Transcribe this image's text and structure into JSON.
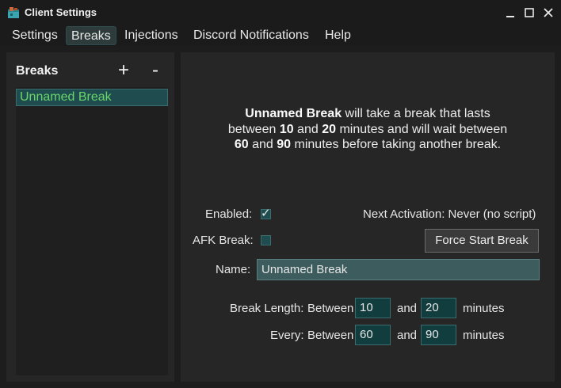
{
  "window": {
    "title": "Client Settings",
    "icons": [
      "app-icon",
      "minimize-icon",
      "maximize-icon",
      "close-icon"
    ]
  },
  "menu": {
    "tabs": [
      {
        "label": "Settings",
        "active": false
      },
      {
        "label": "Breaks",
        "active": true
      },
      {
        "label": "Injections",
        "active": false
      },
      {
        "label": "Discord Notifications",
        "active": false
      },
      {
        "label": "Help",
        "active": false
      }
    ]
  },
  "breaks_panel": {
    "title": "Breaks",
    "add_label": "+",
    "remove_label": "-",
    "items": [
      {
        "label": "Unnamed Break",
        "selected": true
      }
    ]
  },
  "details": {
    "summary": {
      "name": "Unnamed Break",
      "text1": " will take a break that lasts",
      "text2": "between ",
      "min_length": "10",
      "and1": " and ",
      "max_length": "20",
      "text3": " minutes and will wait between",
      "min_every": "60",
      "and2": " and ",
      "max_every": "90",
      "text4": " minutes before taking another break."
    },
    "enabled_label": "Enabled:",
    "enabled": true,
    "afk_label": "AFK Break:",
    "afk": false,
    "next_activation": "Next Activation: Never (no script)",
    "force_start_label": "Force Start Break",
    "name_label": "Name:",
    "name_value": "Unnamed Break",
    "break_length_label": "Break Length:",
    "every_label": "Every:",
    "between_label": "Between",
    "and_label": "and",
    "minutes_label": "minutes",
    "break_length_min": "10",
    "break_length_max": "20",
    "every_min": "60",
    "every_max": "90"
  },
  "colors": {
    "background": "#1d1d1d",
    "panel": "#262626",
    "accent": "#1f4d4f",
    "selected_text": "#6ad66a",
    "name_field": "#3d5c5e"
  }
}
